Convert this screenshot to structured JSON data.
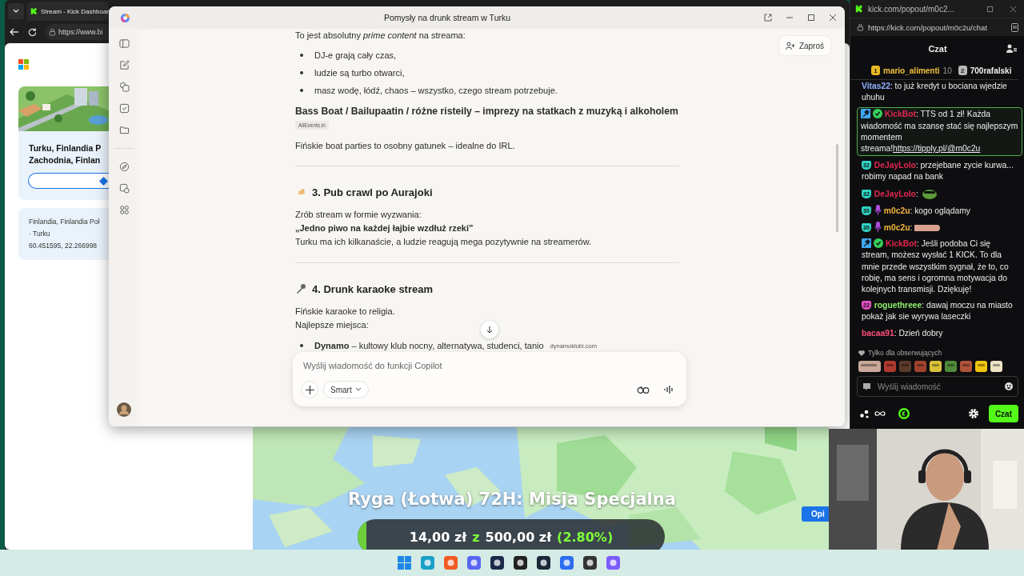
{
  "browser": {
    "tab_title": "Stream - Kick Dashboar",
    "url": "https://www.bi",
    "place_card": {
      "title_lines": [
        "Turku, Finlandia P",
        "Zachodnia, Finlan"
      ]
    },
    "address_lines": [
      "Finlandia, Finlandia Poł",
      "· Turku",
      "60.451595, 22.266998"
    ],
    "map": {
      "button": "Opi"
    }
  },
  "copilot": {
    "title": "Pomysły na drunk stream w Turku",
    "share_button": "Zaproś",
    "content": [
      {
        "kind": "p",
        "text": "To jest absolutny *prime content* na streama:"
      },
      {
        "kind": "bullet",
        "text": "DJ-e grają cały czas,"
      },
      {
        "kind": "bullet",
        "text": "ludzie są turbo otwarci,"
      },
      {
        "kind": "bullet",
        "text": "masz wodę, łódź, chaos – wszystko, czego stream potrzebuje."
      },
      {
        "kind": "subhead",
        "text": "Bass Boat / Bailupaatin / różne risteily – imprezy na statkach z muzyką i alkoholem"
      },
      {
        "kind": "source",
        "text": "AllEvents.in"
      },
      {
        "kind": "p",
        "text": "Fińskie boat parties to osobny gatunek – idealne do IRL."
      },
      {
        "kind": "divider"
      },
      {
        "kind": "heading",
        "text": "3. Pub crawl po Aurajoki"
      },
      {
        "kind": "line",
        "text": "Zrób stream w formie wyzwania:"
      },
      {
        "kind": "boldline",
        "text": "„Jedno piwo na każdej łajbie wzdłuż rzeki”"
      },
      {
        "kind": "line",
        "text": "Turku ma ich kilkanaście, a ludzie reagują mega pozytywnie na streamerów."
      },
      {
        "kind": "divider"
      },
      {
        "kind": "heading",
        "text": "4. Drunk karaoke stream"
      },
      {
        "kind": "line",
        "text": "Fińskie karaoke to religia."
      },
      {
        "kind": "line",
        "text": "Najlepsze miejsca:"
      },
      {
        "kind": "bullet",
        "text": "**Dynamo** – kultowy klub nocny, alternatywa, studenci, tanio",
        "source": "dynamoklubi.com"
      }
    ],
    "composer": {
      "placeholder": "Wyślij wiadomość do funkcji Copilot",
      "mode": "Smart"
    }
  },
  "chat": {
    "window_title": "kick.com/popout/m0c2...",
    "url": "https://kick.com/popout/m0c2u/chat",
    "header": "Czat",
    "gifters": [
      {
        "rank": "1",
        "name": "mario_alimenti",
        "amount": "10",
        "color": "#e8b923"
      },
      {
        "rank": "2",
        "name": "700rafalski",
        "color": "#b8b8b8"
      }
    ],
    "messages": [
      {
        "kind": "text",
        "user": "Vitas22",
        "color": "#8fb3ff",
        "text": ": to już kredyt u bociana wjedzie uhuhu",
        "highlighted": false
      },
      {
        "kind": "text",
        "user": "KickBot",
        "color": "#e3264f",
        "badges": [
          {
            "kind": "mod"
          },
          {
            "kind": "verified"
          }
        ],
        "text": ": TTS od 1 zł! Każda wiadomość ma szansę stać się najlepszym momentem streama!",
        "link": "https://tipply.pl/@m0c2u",
        "highlighted": true
      },
      {
        "kind": "text",
        "user": "DeJayLolo",
        "color": "#e3264f",
        "badges": [
          {
            "kind": "sub",
            "text": "32",
            "color": "#2fd4c4"
          }
        ],
        "text": ": przejebane zycie kurwa... robimy napad na bank",
        "highlighted": false
      },
      {
        "kind": "emote",
        "user": "DeJayLolo",
        "color": "#e3264f",
        "badges": [
          {
            "kind": "sub",
            "text": "32",
            "color": "#2fd4c4"
          }
        ],
        "text": ":",
        "highlighted": false
      },
      {
        "kind": "text",
        "user": "m0c2u",
        "color": "#f5b83d",
        "badges": [
          {
            "kind": "sub",
            "text": "30",
            "color": "#2fd4c4"
          },
          {
            "kind": "mic"
          }
        ],
        "text": ": kogo oglądamy",
        "highlighted": false
      },
      {
        "kind": "emote",
        "user": "m0c2u",
        "color": "#f5b83d",
        "badges": [
          {
            "kind": "sub",
            "text": "30",
            "color": "#2fd4c4"
          },
          {
            "kind": "mic"
          }
        ],
        "text": ":",
        "highlighted": false
      },
      {
        "kind": "text",
        "user": "KickBot",
        "color": "#e3264f",
        "badges": [
          {
            "kind": "mod"
          },
          {
            "kind": "verified"
          }
        ],
        "text": ": Jeśli podoba Ci się stream, możesz wysłać 1 KICK. To dla mnie przede wszystkim sygnał, że to, co robię, ma sens i ogromna motywacja do kolejnych transmisji. Dziękuję!",
        "highlighted": false
      },
      {
        "kind": "text",
        "user": "roguethreee",
        "color": "#8ef06a",
        "badges": [
          {
            "kind": "sub",
            "text": "22",
            "color": "#e04fc2"
          }
        ],
        "text": ": dawaj moczu na miasto pokaż jak sie wyrywa laseczki",
        "highlighted": false
      },
      {
        "kind": "text",
        "user": "bacaa91",
        "color": "#ff4f7b",
        "text": ": Dzień dobry",
        "highlighted": false
      }
    ],
    "followers_only": "Tylko dla obserwujących",
    "input_placeholder": "Wyślij wiadomość",
    "send_button": "Czat"
  },
  "overlay": {
    "title": "Ryga (Łotwa) 72H: Misja Specjalna",
    "goal": {
      "current": "14,00 zł",
      "separator": "z",
      "target": "500,00 zł",
      "percent": "(2.80%)",
      "level": 0.028
    }
  }
}
